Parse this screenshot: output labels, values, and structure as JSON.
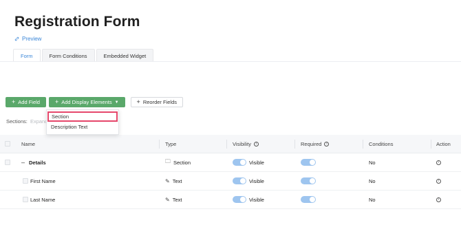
{
  "page": {
    "title": "Registration Form",
    "preview_label": "Preview"
  },
  "tabs": [
    {
      "label": "Form",
      "active": true
    },
    {
      "label": "Form Conditions",
      "active": false
    },
    {
      "label": "Embedded Widget",
      "active": false
    }
  ],
  "toolbar": {
    "add_field": "Add Field",
    "add_display_elements": "Add Display Elements",
    "reorder_fields": "Reorder Fields"
  },
  "sections_bar": {
    "label": "Sections:",
    "expand": "Expand"
  },
  "dropdown": {
    "items": [
      "Section",
      "Description Text"
    ],
    "highlighted_index": 0
  },
  "table": {
    "columns": [
      "Name",
      "Type",
      "Visibility",
      "Required",
      "Conditions",
      "Action"
    ],
    "rows": [
      {
        "name": "Details",
        "type": "Section",
        "type_icon": "folder-icon",
        "visibility": "Visible",
        "conditions": "No",
        "is_section": true
      },
      {
        "name": "First Name",
        "type": "Text",
        "type_icon": "pencil-icon",
        "visibility": "Visible",
        "conditions": "No",
        "is_section": false
      },
      {
        "name": "Last Name",
        "type": "Text",
        "type_icon": "pencil-icon",
        "visibility": "Visible",
        "conditions": "No",
        "is_section": false
      }
    ]
  },
  "colors": {
    "accent": "#3a86d8",
    "button_green": "#5aa86a",
    "toggle_on": "#9ec5ef",
    "highlight": "#e5466a"
  }
}
